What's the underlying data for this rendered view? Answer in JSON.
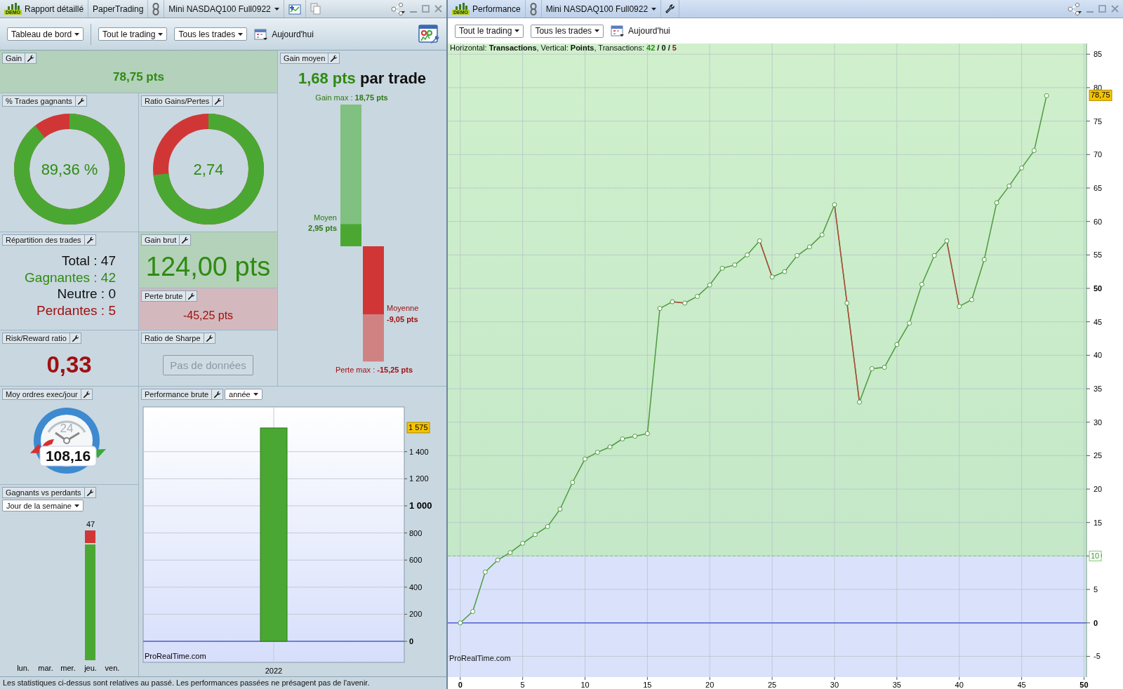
{
  "left_window": {
    "badge": "DEMO",
    "title": "Rapport détaillé",
    "account": "PaperTrading",
    "instrument": "Mini NASDAQ100 Full0922"
  },
  "left_toolbar": {
    "view": "Tableau de bord",
    "scope": "Tout le trading",
    "filter": "Tous les trades",
    "date": "Aujourd'hui"
  },
  "gain": {
    "title": "Gain",
    "value": "78,75 pts"
  },
  "win_rate": {
    "title": "% Trades gagnants",
    "value": "89,36 %",
    "kind": "percent"
  },
  "gain_loss_ratio": {
    "title": "Ratio Gains/Pertes",
    "value": "2,74",
    "kind": "ratio"
  },
  "average_gain": {
    "title": "Gain moyen",
    "value": "1,68 pts",
    "suffix": "par trade",
    "max_gain_label": "Gain max :",
    "max_gain": "18,75 pts",
    "avg_win_label": "Moyen",
    "avg_win": "2,95 pts",
    "avg_loss_label": "Moyenne",
    "avg_loss": "-9,05 pts",
    "max_loss_label": "Perte max :",
    "max_loss": "-15,25 pts"
  },
  "breakdown": {
    "title": "Répartition des trades",
    "rows": [
      {
        "text": "Total : 47",
        "kind": "total"
      },
      {
        "text": "Gagnantes : 42",
        "kind": "win"
      },
      {
        "text": "Neutre : 0",
        "kind": "neutral"
      },
      {
        "text": "Perdantes : 5",
        "kind": "loss"
      }
    ]
  },
  "gross_gain": {
    "title": "Gain brut",
    "value": "124,00 pts"
  },
  "gross_loss": {
    "title": "Perte brute",
    "value": "-45,25 pts"
  },
  "risk_reward": {
    "title": "Risk/Reward ratio",
    "value": "0,33"
  },
  "sharpe": {
    "title": "Ratio de Sharpe",
    "button": "Pas de données",
    "disabled": true
  },
  "orders_per_day": {
    "title": "Moy ordres exec/jour",
    "clock_label": "24",
    "value": "108,16"
  },
  "winners_losers": {
    "title": "Gagnants vs perdants",
    "grouping": "Jour de la semaine",
    "days": [
      {
        "label": "lun."
      },
      {
        "label": "mar."
      },
      {
        "label": "mer."
      },
      {
        "label": "jeu.",
        "total": "47",
        "level": 0.894
      },
      {
        "label": "ven."
      }
    ]
  },
  "gross_performance": {
    "title": "Performance brute",
    "period": "année",
    "last_value_label": "1 575",
    "source": "ProRealTime.com",
    "chart_data": {
      "type": "bar",
      "grid": true,
      "ref_lines": [
        {
          "axis": "y",
          "value": 0,
          "color": "#5060d0"
        }
      ],
      "categories": [
        "2022"
      ],
      "values": [
        1575
      ],
      "ylim": [
        -155,
        1730
      ],
      "yticks": [
        0,
        200,
        400,
        600,
        800,
        {
          "value": 1000,
          "label": "1 000"
        },
        {
          "value": 1200,
          "label": "1 200"
        },
        {
          "value": 1400,
          "label": "1 400"
        }
      ]
    }
  },
  "footer": "Les statistiques ci-dessus sont relatives au passé. Les performances passées ne présagent pas de l'avenir.",
  "right_window": {
    "badge": "DEMO",
    "title": "Performance",
    "instrument": "Mini NASDAQ100 Full0922"
  },
  "right_toolbar": {
    "scope": "Tout le trading",
    "filter": "Tous les trades",
    "date": "Aujourd'hui"
  },
  "performance_chart": {
    "info": "Horizontal: **Transactions**, Vertical: **Points**, Transactions:",
    "counts": [
      {
        "text": "42",
        "kind": "win"
      },
      {
        "text": "/",
        "kind": "sep"
      },
      {
        "text": "0",
        "kind": "neutral"
      },
      {
        "text": "/",
        "kind": "sep"
      },
      {
        "text": "5",
        "kind": "loss"
      }
    ],
    "last_value_label": "78,75",
    "source": "ProRealTime.com",
    "chart_data": {
      "type": "line",
      "grid": true,
      "ref_lines": [
        {
          "axis": "y",
          "value": 0,
          "color": "#5060d0"
        },
        {
          "axis": "y",
          "value": 10,
          "color": "#7cc870",
          "label": "10"
        }
      ],
      "bands": [
        {
          "axis": "y",
          "from": 10,
          "to": 86.6,
          "color": "#c4e8c8"
        }
      ],
      "xlim": [
        -1,
        50.2
      ],
      "ylim": [
        -8.1,
        86.6
      ],
      "xticks": [
        0,
        5,
        10,
        15,
        20,
        25,
        30,
        35,
        40,
        45,
        50
      ],
      "yticks": [
        -5,
        0,
        5,
        10,
        15,
        20,
        25,
        30,
        35,
        40,
        45,
        50,
        55,
        60,
        65,
        70,
        75,
        80,
        85
      ],
      "x": [
        0,
        1,
        2,
        3,
        4,
        5,
        6,
        7,
        8,
        9,
        10,
        11,
        12,
        13,
        14,
        15,
        16,
        17,
        18,
        19,
        20,
        21,
        22,
        23,
        24,
        25,
        26,
        27,
        28,
        29,
        30,
        31,
        32,
        33,
        34,
        35,
        36,
        37,
        38,
        39,
        40,
        41,
        42,
        43,
        44,
        45,
        46,
        47
      ],
      "series": [
        {
          "color": "#4e9a3e",
          "marker": "o",
          "values": [
            0,
            1.7,
            7.6,
            9.4,
            10.5,
            11.9,
            13.2,
            14.4,
            17,
            21,
            24.5,
            25.5,
            26.3,
            27.5,
            27.9,
            28.3,
            47,
            48,
            47.8,
            48.8,
            50.5,
            53,
            53.5,
            55,
            57.1,
            51.7,
            52.5,
            54.9,
            56.2,
            58,
            62.5,
            47.8,
            33,
            38,
            38.2,
            41.6,
            44.8,
            50.6,
            54.9,
            57.1,
            47.3,
            48.3,
            54.3,
            62.8,
            65.3,
            68,
            70.6,
            78.8
          ]
        },
        {
          "color": "#b24a3c",
          "values": [
            null,
            null,
            null,
            null,
            null,
            null,
            null,
            null,
            null,
            null,
            null,
            null,
            null,
            null,
            null,
            null,
            null,
            48,
            47.8,
            null,
            null,
            null,
            null,
            null,
            57.1,
            51.7,
            null,
            null,
            null,
            null,
            62.5,
            47.8,
            33,
            null,
            null,
            null,
            null,
            null,
            null,
            57.1,
            47.3,
            null,
            null,
            null,
            null,
            null,
            null,
            null
          ]
        }
      ]
    }
  }
}
